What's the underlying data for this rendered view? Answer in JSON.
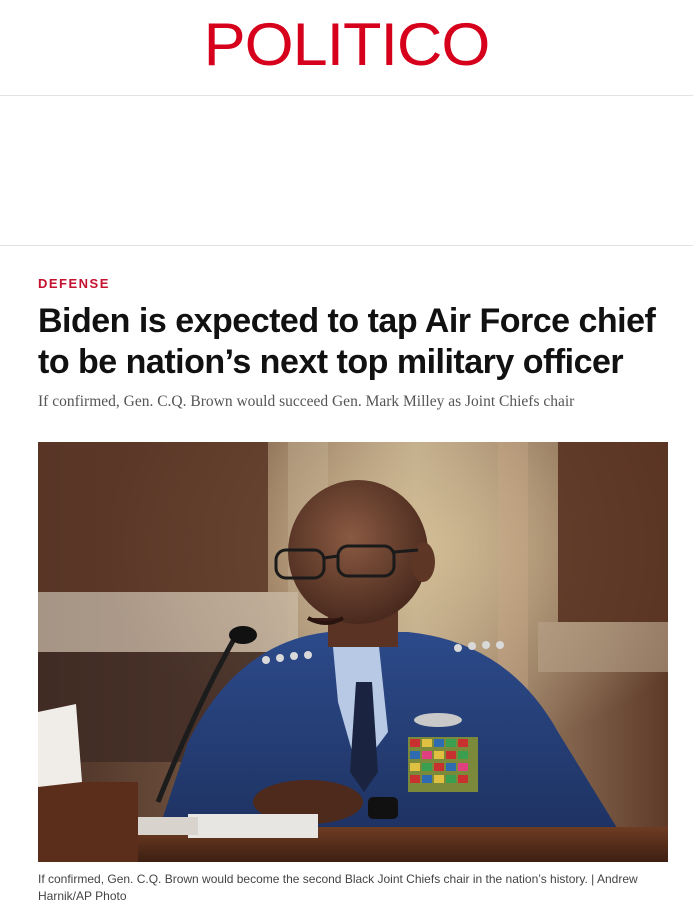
{
  "masthead": {
    "logo_text": "POLITICO",
    "brand_color": "#d6001c"
  },
  "article": {
    "section": "DEFENSE",
    "headline": "Biden is expected to tap Air Force chief to be nation’s next top military officer",
    "dek": "If confirmed, Gen. C.Q. Brown would succeed Gen. Mark Milley as Joint Chiefs chair",
    "photo": {
      "caption": "If confirmed, Gen. C.Q. Brown would become the second Black Joint Chiefs chair in the nation’s history.",
      "separator": "|",
      "credit": "Andrew Harnik/AP Photo"
    }
  },
  "colors": {
    "section_kicker": "#c4122f",
    "headline": "#111111",
    "dek": "#555555",
    "caption": "#444444"
  }
}
